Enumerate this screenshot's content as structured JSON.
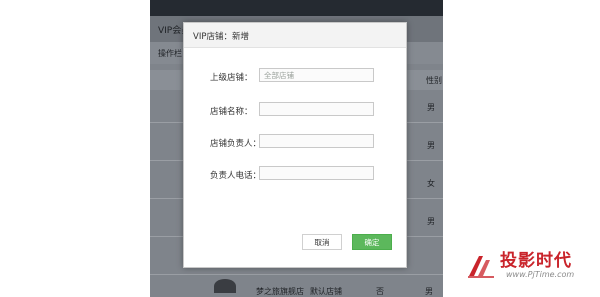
{
  "background": {
    "header_text": "VIP会员",
    "subbar_text": "操作栏",
    "table_header_last": "性别",
    "gender_values": [
      "男",
      "男",
      "女",
      "男"
    ],
    "bottom_row": {
      "name": "梦之旅旗舰店",
      "store": "默认店铺",
      "status": "否",
      "gender": "男"
    }
  },
  "dialog": {
    "title": "VIP店铺：新增",
    "fields": [
      {
        "label": "上级店铺：",
        "value": "",
        "placeholder": "全部店铺"
      },
      {
        "label": "店铺名称：",
        "value": "",
        "placeholder": ""
      },
      {
        "label": "店铺负责人：",
        "value": "",
        "placeholder": ""
      },
      {
        "label": "负责人电话：",
        "value": "",
        "placeholder": ""
      }
    ],
    "cancel_label": "取消",
    "confirm_label": "确定"
  },
  "watermark": {
    "name": "投影时代",
    "url": "www.PjTime.com"
  },
  "colors": {
    "confirm": "#5cb85c",
    "overlay": "#7f848b",
    "watermark": "#c9242b"
  }
}
